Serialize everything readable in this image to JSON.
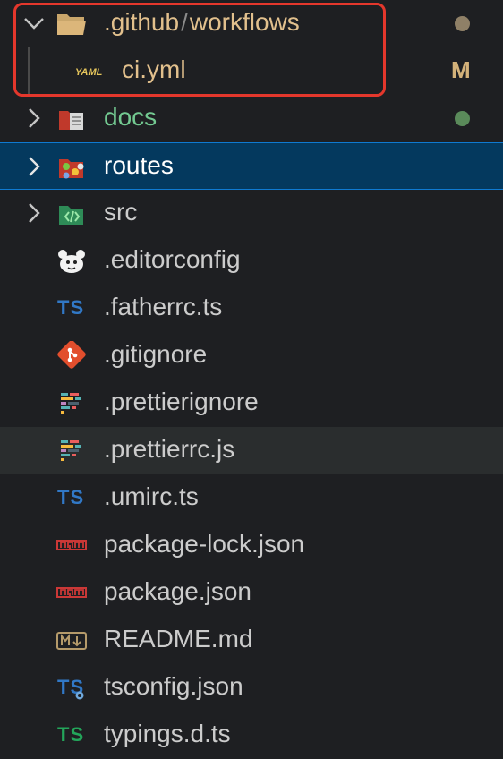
{
  "explorer": {
    "rows": [
      {
        "label_a": ".github",
        "sep": "/",
        "label_b": "workflows",
        "status": "dot",
        "status_color": "#8f8067"
      },
      {
        "label": "ci.yml",
        "status": "M",
        "status_color": "#d4b27a"
      },
      {
        "label": "docs",
        "status": "dot",
        "status_color": "#5a8a5a"
      },
      {
        "label": "routes"
      },
      {
        "label": "src"
      },
      {
        "label": ".editorconfig"
      },
      {
        "label": ".fatherrc.ts",
        "icon_text": "TS"
      },
      {
        "label": ".gitignore"
      },
      {
        "label": ".prettierignore"
      },
      {
        "label": ".prettierrc.js"
      },
      {
        "label": ".umirc.ts",
        "icon_text": "TS"
      },
      {
        "label": "package-lock.json"
      },
      {
        "label": "package.json"
      },
      {
        "label": "README.md"
      },
      {
        "label": "tsconfig.json",
        "icon_text": "TS"
      },
      {
        "label": "typings.d.ts",
        "icon_text": "TS"
      }
    ]
  },
  "colors": {
    "background": "#1e1f22",
    "selected_bg": "#04395e",
    "selected_border": "#0f7ad1",
    "highlight_box": "#e4372c",
    "modified_text": "#e2c08d",
    "added_text": "#73c991",
    "ts_blue": "#3178c6",
    "ts_green": "#23a55a"
  }
}
